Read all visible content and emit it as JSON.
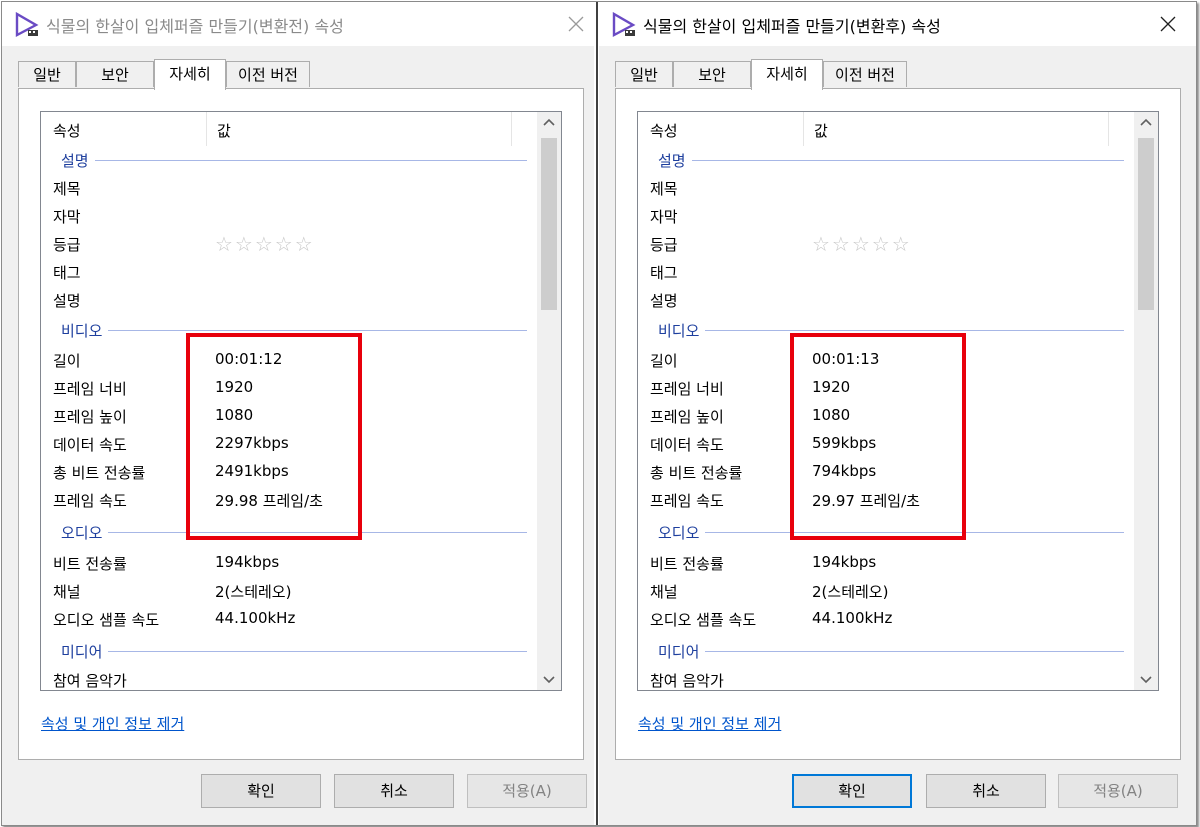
{
  "windows": [
    {
      "title": "식물의 한살이 입체퍼즐 만들기(변환전) 속성",
      "tabs": [
        "일반",
        "보안",
        "자세히",
        "이전 버전"
      ],
      "active_tab": "자세히",
      "columns": {
        "property": "속성",
        "value": "값"
      },
      "groups": {
        "description": "설명",
        "video": "비디오",
        "audio": "오디오",
        "media": "미디어"
      },
      "description_rows": [
        "제목",
        "자막",
        "등급",
        "태그",
        "설명"
      ],
      "rating_stars": "☆☆☆☆☆",
      "video_rows": [
        {
          "label": "길이",
          "value": "00:01:12"
        },
        {
          "label": "프레임 너비",
          "value": "1920"
        },
        {
          "label": "프레임 높이",
          "value": "1080"
        },
        {
          "label": "데이터 속도",
          "value": "2297kbps"
        },
        {
          "label": "총 비트 전송률",
          "value": "2491kbps"
        },
        {
          "label": "프레임 속도",
          "value": "29.98 프레임/초"
        }
      ],
      "audio_rows": [
        {
          "label": "비트 전송률",
          "value": "194kbps"
        },
        {
          "label": "채널",
          "value": "2(스테레오)"
        },
        {
          "label": "오디오 샘플 속도",
          "value": "44.100kHz"
        }
      ],
      "media_rows": [
        "참여 음악가"
      ],
      "remove_link": "속성 및 개인 정보 제거",
      "buttons": {
        "ok": "확인",
        "cancel": "취소",
        "apply": "적용(A)"
      }
    },
    {
      "title": "식물의 한살이 입체퍼즐 만들기(변환후) 속성",
      "tabs": [
        "일반",
        "보안",
        "자세히",
        "이전 버전"
      ],
      "active_tab": "자세히",
      "columns": {
        "property": "속성",
        "value": "값"
      },
      "groups": {
        "description": "설명",
        "video": "비디오",
        "audio": "오디오",
        "media": "미디어"
      },
      "description_rows": [
        "제목",
        "자막",
        "등급",
        "태그",
        "설명"
      ],
      "rating_stars": "☆☆☆☆☆",
      "video_rows": [
        {
          "label": "길이",
          "value": "00:01:13"
        },
        {
          "label": "프레임 너비",
          "value": "1920"
        },
        {
          "label": "프레임 높이",
          "value": "1080"
        },
        {
          "label": "데이터 속도",
          "value": "599kbps"
        },
        {
          "label": "총 비트 전송률",
          "value": "794kbps"
        },
        {
          "label": "프레임 속도",
          "value": "29.97 프레임/초"
        }
      ],
      "audio_rows": [
        {
          "label": "비트 전송률",
          "value": "194kbps"
        },
        {
          "label": "채널",
          "value": "2(스테레오)"
        },
        {
          "label": "오디오 샘플 속도",
          "value": "44.100kHz"
        }
      ],
      "media_rows": [
        "참여 음악가"
      ],
      "remove_link": "속성 및 개인 정보 제거",
      "buttons": {
        "ok": "확인",
        "cancel": "취소",
        "apply": "적용(A)"
      }
    }
  ],
  "colors": {
    "highlight_box": "#e8000c",
    "group_header": "#1e3f9e",
    "link": "#0055cc",
    "default_button_border": "#0078d7"
  }
}
